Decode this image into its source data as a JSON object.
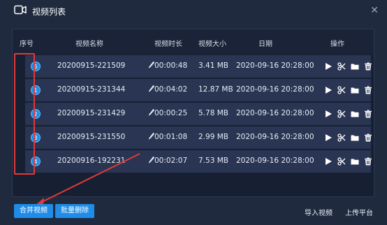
{
  "window": {
    "title": "视频列表"
  },
  "table": {
    "headers": {
      "index": "序号",
      "name": "视频名称",
      "duration": "视频时长",
      "size": "视频大小",
      "date": "日期",
      "actions": "操作"
    },
    "rows": [
      {
        "index": "5",
        "name": "20200915-221509",
        "duration": "00:00:48",
        "size": "3.41 MB",
        "date": "2020-09-16 20:28:00"
      },
      {
        "index": "1",
        "name": "20200915-231344",
        "duration": "00:04:02",
        "size": "12.87 MB",
        "date": "2020-09-16 20:28:00"
      },
      {
        "index": "2",
        "name": "20200915-231429",
        "duration": "00:00:25",
        "size": "5.78 MB",
        "date": "2020-09-16 20:28:00"
      },
      {
        "index": "3",
        "name": "20200915-231550",
        "duration": "00:01:08",
        "size": "2.99 MB",
        "date": "2020-09-16 20:28:00"
      },
      {
        "index": "4",
        "name": "20200916-192231",
        "duration": "00:02:07",
        "size": "7.53 MB",
        "date": "2020-09-16 20:28:00"
      }
    ]
  },
  "footer": {
    "merge_label": "合并视频",
    "batch_delete_label": "批量删除",
    "import_label": "导入视频",
    "upload_label": "上传平台"
  },
  "colors": {
    "accent": "#1e8ce8",
    "annotation": "#e03a3a"
  },
  "icons": [
    "video-icon",
    "close-icon",
    "edit-icon",
    "play-icon",
    "cut-icon",
    "folder-icon",
    "delete-icon"
  ]
}
